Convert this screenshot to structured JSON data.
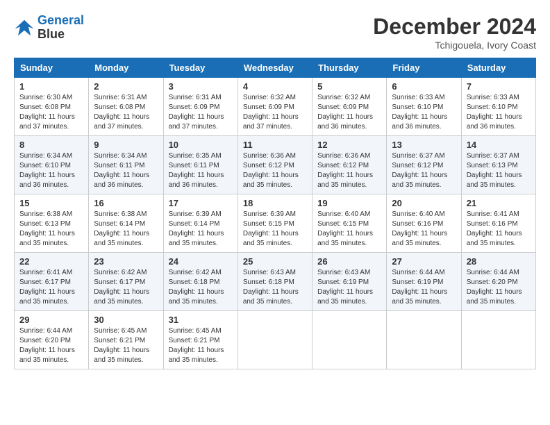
{
  "header": {
    "logo_line1": "General",
    "logo_line2": "Blue",
    "month_year": "December 2024",
    "location": "Tchigouela, Ivory Coast"
  },
  "weekdays": [
    "Sunday",
    "Monday",
    "Tuesday",
    "Wednesday",
    "Thursday",
    "Friday",
    "Saturday"
  ],
  "weeks": [
    [
      {
        "day": "1",
        "sunrise": "6:30 AM",
        "sunset": "6:08 PM",
        "daylight": "11 hours and 37 minutes."
      },
      {
        "day": "2",
        "sunrise": "6:31 AM",
        "sunset": "6:08 PM",
        "daylight": "11 hours and 37 minutes."
      },
      {
        "day": "3",
        "sunrise": "6:31 AM",
        "sunset": "6:09 PM",
        "daylight": "11 hours and 37 minutes."
      },
      {
        "day": "4",
        "sunrise": "6:32 AM",
        "sunset": "6:09 PM",
        "daylight": "11 hours and 37 minutes."
      },
      {
        "day": "5",
        "sunrise": "6:32 AM",
        "sunset": "6:09 PM",
        "daylight": "11 hours and 36 minutes."
      },
      {
        "day": "6",
        "sunrise": "6:33 AM",
        "sunset": "6:10 PM",
        "daylight": "11 hours and 36 minutes."
      },
      {
        "day": "7",
        "sunrise": "6:33 AM",
        "sunset": "6:10 PM",
        "daylight": "11 hours and 36 minutes."
      }
    ],
    [
      {
        "day": "8",
        "sunrise": "6:34 AM",
        "sunset": "6:10 PM",
        "daylight": "11 hours and 36 minutes."
      },
      {
        "day": "9",
        "sunrise": "6:34 AM",
        "sunset": "6:11 PM",
        "daylight": "11 hours and 36 minutes."
      },
      {
        "day": "10",
        "sunrise": "6:35 AM",
        "sunset": "6:11 PM",
        "daylight": "11 hours and 36 minutes."
      },
      {
        "day": "11",
        "sunrise": "6:36 AM",
        "sunset": "6:12 PM",
        "daylight": "11 hours and 35 minutes."
      },
      {
        "day": "12",
        "sunrise": "6:36 AM",
        "sunset": "6:12 PM",
        "daylight": "11 hours and 35 minutes."
      },
      {
        "day": "13",
        "sunrise": "6:37 AM",
        "sunset": "6:12 PM",
        "daylight": "11 hours and 35 minutes."
      },
      {
        "day": "14",
        "sunrise": "6:37 AM",
        "sunset": "6:13 PM",
        "daylight": "11 hours and 35 minutes."
      }
    ],
    [
      {
        "day": "15",
        "sunrise": "6:38 AM",
        "sunset": "6:13 PM",
        "daylight": "11 hours and 35 minutes."
      },
      {
        "day": "16",
        "sunrise": "6:38 AM",
        "sunset": "6:14 PM",
        "daylight": "11 hours and 35 minutes."
      },
      {
        "day": "17",
        "sunrise": "6:39 AM",
        "sunset": "6:14 PM",
        "daylight": "11 hours and 35 minutes."
      },
      {
        "day": "18",
        "sunrise": "6:39 AM",
        "sunset": "6:15 PM",
        "daylight": "11 hours and 35 minutes."
      },
      {
        "day": "19",
        "sunrise": "6:40 AM",
        "sunset": "6:15 PM",
        "daylight": "11 hours and 35 minutes."
      },
      {
        "day": "20",
        "sunrise": "6:40 AM",
        "sunset": "6:16 PM",
        "daylight": "11 hours and 35 minutes."
      },
      {
        "day": "21",
        "sunrise": "6:41 AM",
        "sunset": "6:16 PM",
        "daylight": "11 hours and 35 minutes."
      }
    ],
    [
      {
        "day": "22",
        "sunrise": "6:41 AM",
        "sunset": "6:17 PM",
        "daylight": "11 hours and 35 minutes."
      },
      {
        "day": "23",
        "sunrise": "6:42 AM",
        "sunset": "6:17 PM",
        "daylight": "11 hours and 35 minutes."
      },
      {
        "day": "24",
        "sunrise": "6:42 AM",
        "sunset": "6:18 PM",
        "daylight": "11 hours and 35 minutes."
      },
      {
        "day": "25",
        "sunrise": "6:43 AM",
        "sunset": "6:18 PM",
        "daylight": "11 hours and 35 minutes."
      },
      {
        "day": "26",
        "sunrise": "6:43 AM",
        "sunset": "6:19 PM",
        "daylight": "11 hours and 35 minutes."
      },
      {
        "day": "27",
        "sunrise": "6:44 AM",
        "sunset": "6:19 PM",
        "daylight": "11 hours and 35 minutes."
      },
      {
        "day": "28",
        "sunrise": "6:44 AM",
        "sunset": "6:20 PM",
        "daylight": "11 hours and 35 minutes."
      }
    ],
    [
      {
        "day": "29",
        "sunrise": "6:44 AM",
        "sunset": "6:20 PM",
        "daylight": "11 hours and 35 minutes."
      },
      {
        "day": "30",
        "sunrise": "6:45 AM",
        "sunset": "6:21 PM",
        "daylight": "11 hours and 35 minutes."
      },
      {
        "day": "31",
        "sunrise": "6:45 AM",
        "sunset": "6:21 PM",
        "daylight": "11 hours and 35 minutes."
      },
      null,
      null,
      null,
      null
    ]
  ]
}
